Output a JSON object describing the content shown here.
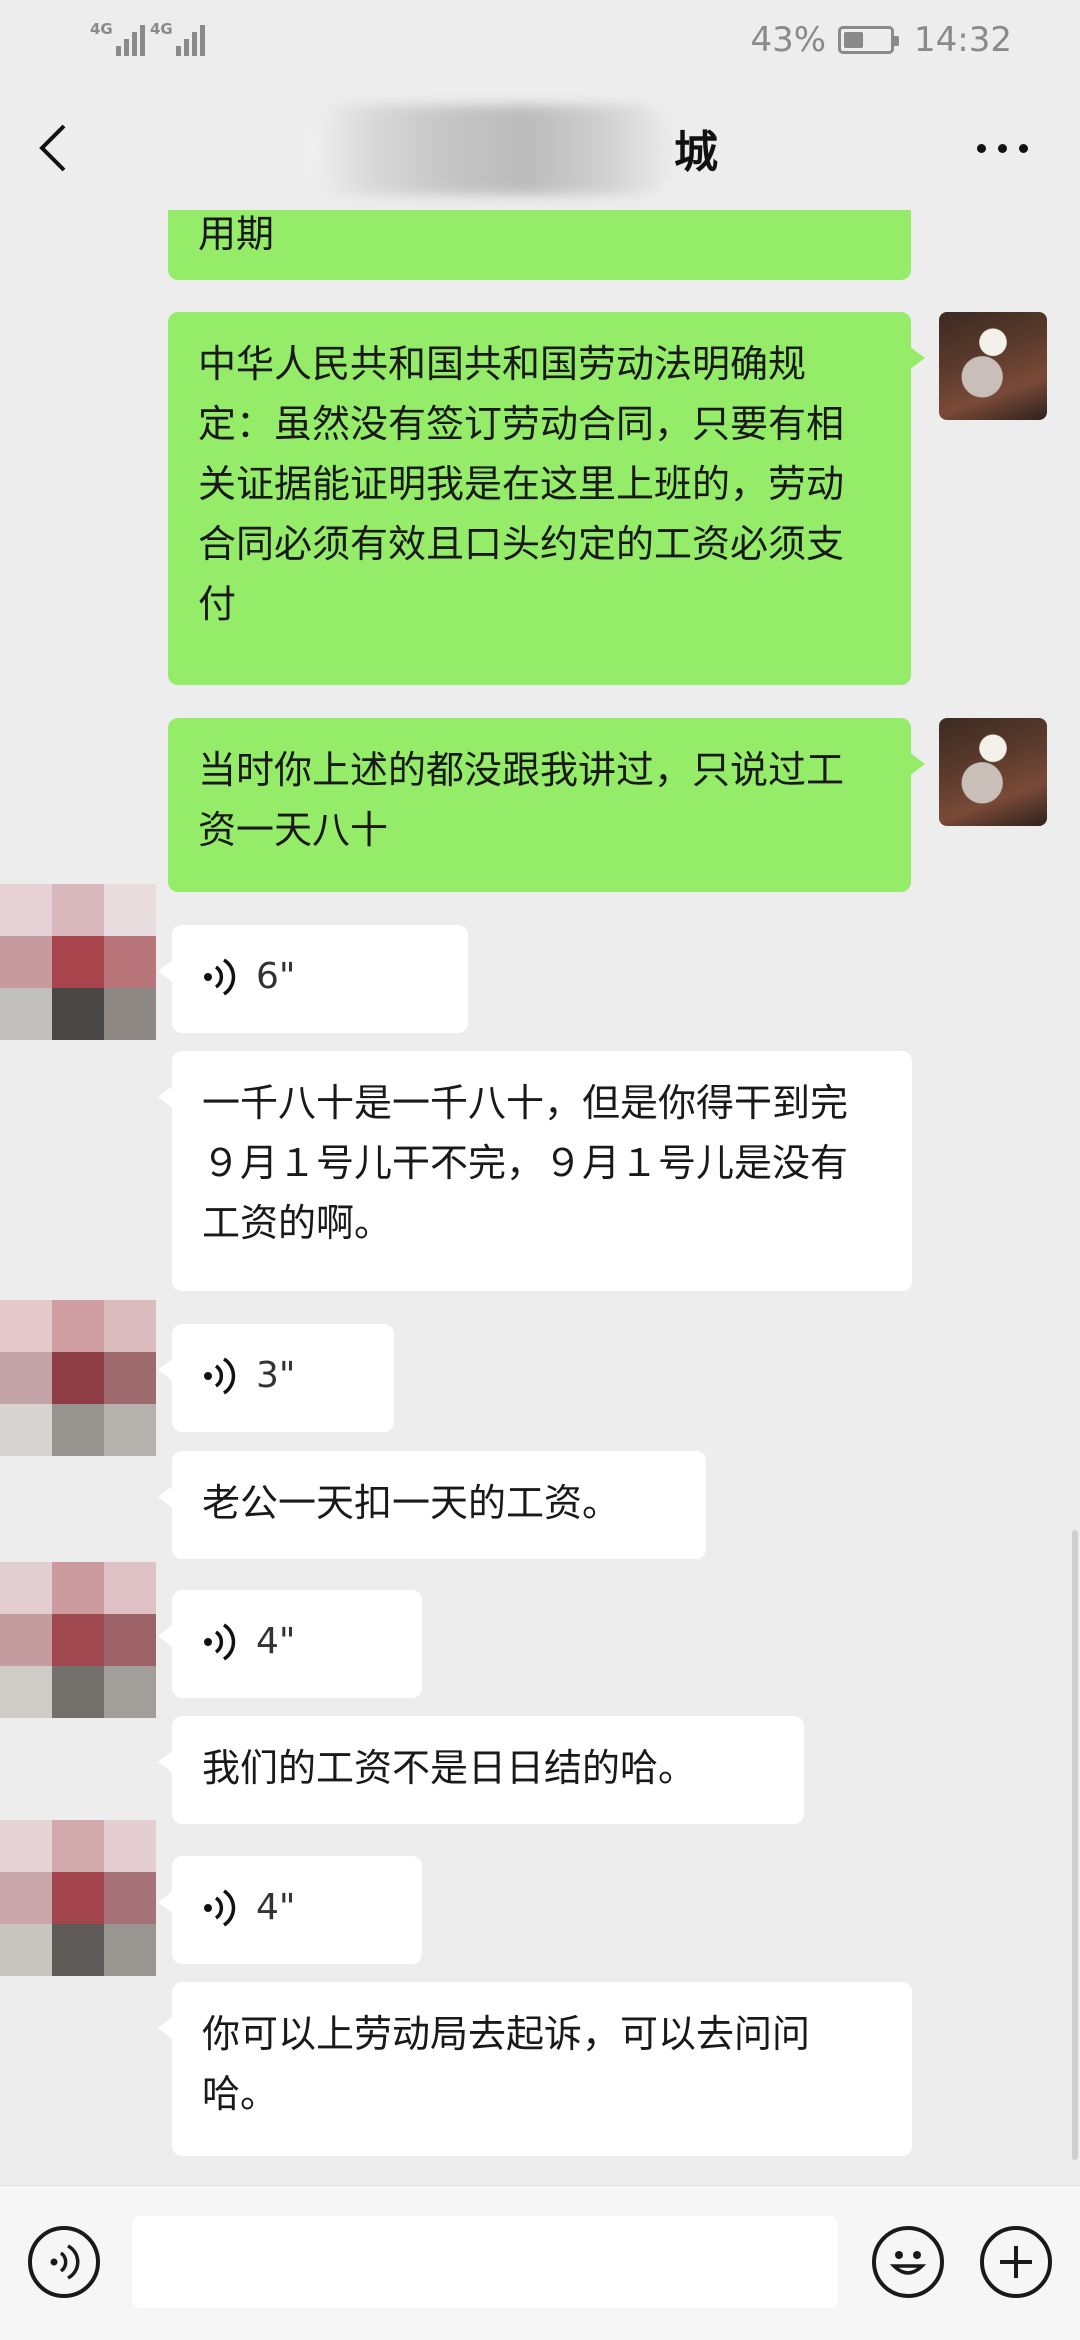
{
  "status_bar": {
    "signal1": "4G",
    "signal2": "4G",
    "battery": "43%",
    "battery_level": 0.43,
    "time": "14:32"
  },
  "header": {
    "title_suffix": "城",
    "back_icon": "chevron-left-icon",
    "more_icon": "more-dots-icon"
  },
  "messages": [
    {
      "side": "out",
      "type": "text",
      "text": "用期"
    },
    {
      "side": "out",
      "type": "text",
      "text": "中华人民共和国共和国劳动法明确规定：虽然没有签订劳动合同，只要有相关证据能证明我是在这里上班的，劳动合同必须有效且口头约定的工资必须支付"
    },
    {
      "side": "out",
      "type": "text",
      "text": "当时你上述的都没跟我讲过，只说过工资一天八十"
    },
    {
      "side": "in",
      "type": "voice",
      "duration": "6\""
    },
    {
      "side": "in",
      "type": "text",
      "text": "一千八十是一千八十，但是你得干到完９月１号儿干不完，９月１号儿是没有工资的啊。"
    },
    {
      "side": "in",
      "type": "voice",
      "duration": "3\""
    },
    {
      "side": "in",
      "type": "text",
      "text": "老公一天扣一天的工资。"
    },
    {
      "side": "in",
      "type": "voice",
      "duration": "4\""
    },
    {
      "side": "in",
      "type": "text",
      "text": "我们的工资不是日日结的哈。"
    },
    {
      "side": "in",
      "type": "voice",
      "duration": "4\""
    },
    {
      "side": "in",
      "type": "text",
      "text": "你可以上劳动局去起诉，可以去问问哈。"
    }
  ],
  "input_bar": {
    "voice_icon": "voice-input-icon",
    "emoji_icon": "emoji-icon",
    "plus_icon": "plus-icon"
  },
  "colors": {
    "outgoing_bubble": "#95ec69",
    "incoming_bubble": "#ffffff",
    "background": "#ededed"
  }
}
